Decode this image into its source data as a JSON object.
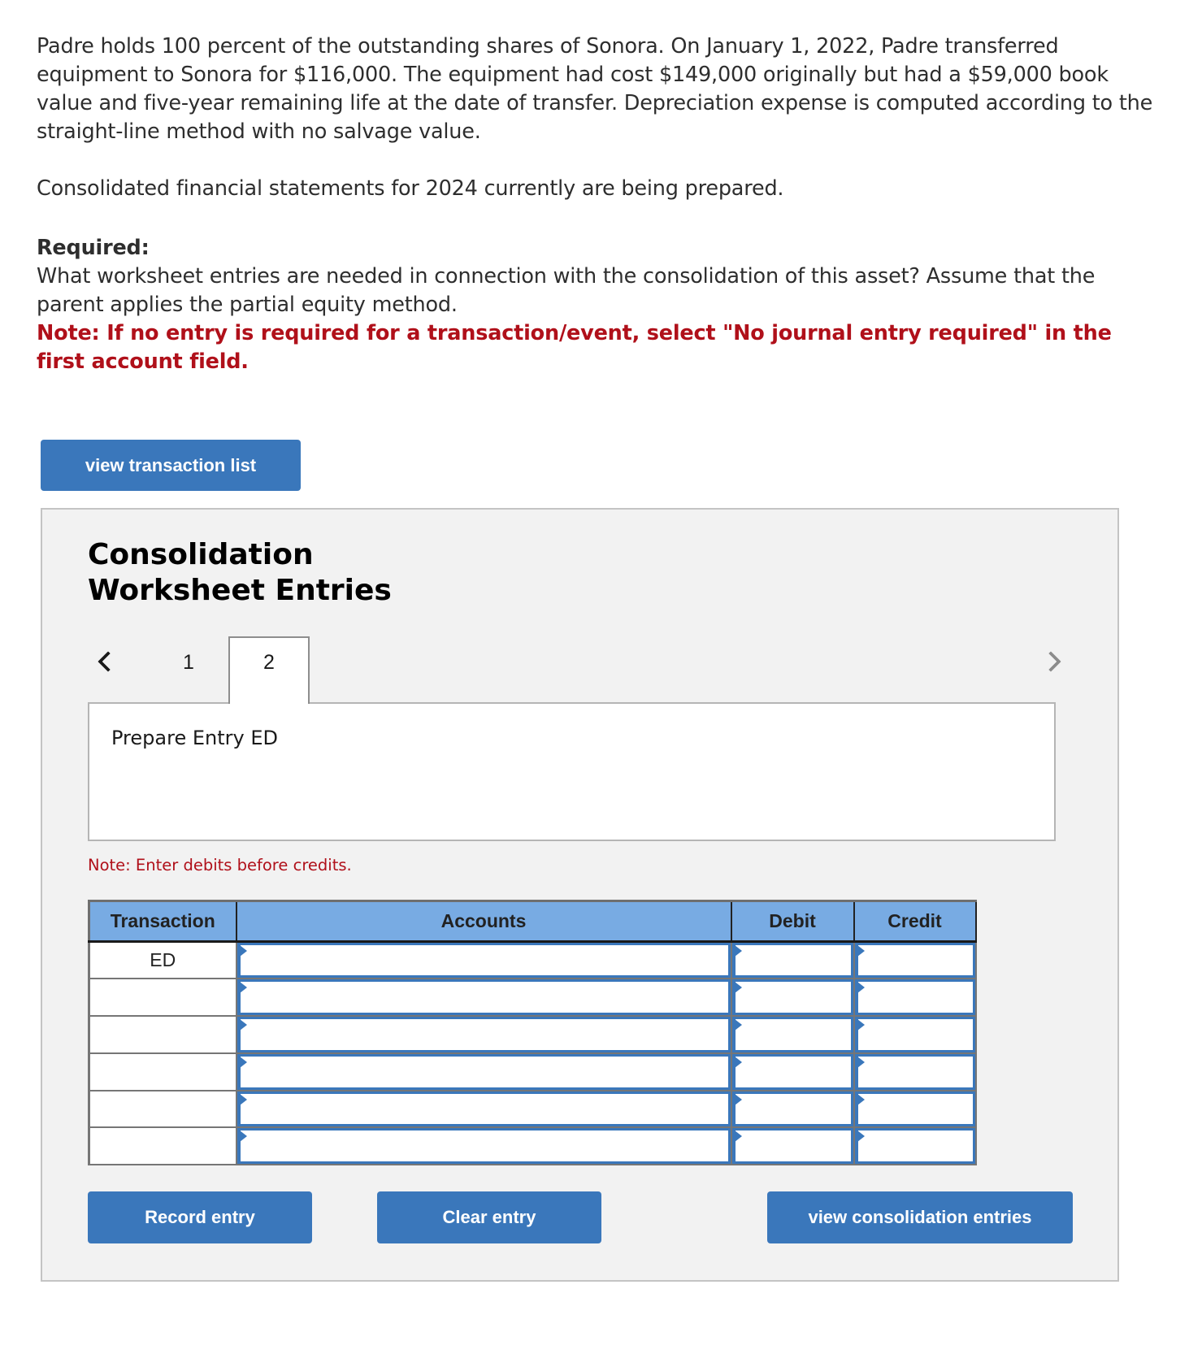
{
  "problem": {
    "paragraph1": "Padre holds 100 percent of the outstanding shares of Sonora. On January 1, 2022, Padre transferred equipment to Sonora for $116,000. The equipment had cost $149,000 originally but had a $59,000 book value and five-year remaining life at the date of transfer. Depreciation expense is computed according to the straight-line method with no salvage value.",
    "paragraph2": "Consolidated financial statements for 2024 currently are being prepared.",
    "required_label": "Required:",
    "required_text": "What worksheet entries are needed in connection with the consolidation of this asset? Assume that the parent applies the partial equity method.",
    "note": "Note: If no entry is required for a transaction/event, select \"No journal entry required\" in the first account field."
  },
  "buttons": {
    "view_transaction_list": "view transaction list",
    "record_entry": "Record entry",
    "clear_entry": "Clear entry",
    "view_consolidation_entries": "view consolidation entries"
  },
  "worksheet": {
    "title_line1": "Consolidation",
    "title_line2": "Worksheet Entries",
    "tabs": [
      {
        "label": "1",
        "active": false
      },
      {
        "label": "2",
        "active": true
      }
    ],
    "prompt": "Prepare Entry ED",
    "debit_note": "Note: Enter debits before credits.",
    "table": {
      "headers": [
        "Transaction",
        "Accounts",
        "Debit",
        "Credit"
      ],
      "rows": [
        {
          "transaction": "ED",
          "account": "",
          "debit": "",
          "credit": ""
        },
        {
          "transaction": "",
          "account": "",
          "debit": "",
          "credit": ""
        },
        {
          "transaction": "",
          "account": "",
          "debit": "",
          "credit": ""
        },
        {
          "transaction": "",
          "account": "",
          "debit": "",
          "credit": ""
        },
        {
          "transaction": "",
          "account": "",
          "debit": "",
          "credit": ""
        },
        {
          "transaction": "",
          "account": "",
          "debit": "",
          "credit": ""
        }
      ]
    }
  },
  "icons": {
    "prev": "chevron-left-icon",
    "next": "chevron-right-icon"
  },
  "colors": {
    "button_blue": "#3a77bb",
    "header_blue": "#78abe3",
    "note_red": "#b0101a",
    "panel_bg": "#f2f2f2"
  }
}
